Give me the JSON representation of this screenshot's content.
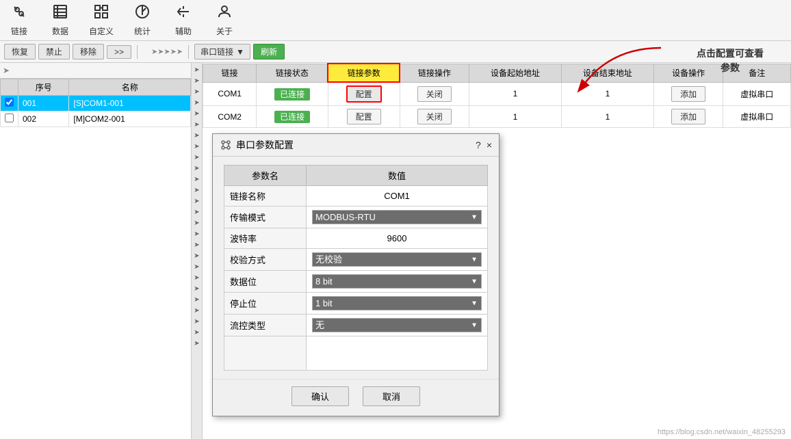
{
  "toolbar": {
    "items": [
      {
        "icon": "🔗",
        "label": "链接"
      },
      {
        "icon": "📄",
        "label": "数据"
      },
      {
        "icon": "📋",
        "label": "自定义"
      },
      {
        "icon": "📊",
        "label": "统计"
      },
      {
        "icon": "📎",
        "label": "辅助"
      },
      {
        "icon": "👤",
        "label": "关于"
      }
    ]
  },
  "second_toolbar": {
    "restore": "恢复",
    "disable": "禁止",
    "remove": "移除",
    "forward": ">>",
    "port_link": "串口链接",
    "refresh": "刷新"
  },
  "left_table": {
    "headers": [
      "序号",
      "名称"
    ],
    "rows": [
      {
        "id": "001",
        "name": "[S]COM1-001",
        "selected": true
      },
      {
        "id": "002",
        "name": "[M]COM2-001",
        "selected": false
      }
    ]
  },
  "right_table": {
    "headers": [
      "链接",
      "链接状态",
      "链接参数",
      "链接操作",
      "设备起始地址",
      "设备结束地址",
      "设备操作",
      "备注"
    ],
    "rows": [
      {
        "link": "COM1",
        "status": "已连接",
        "config_btn": "配置",
        "close_btn": "关闭",
        "start_addr": "1",
        "end_addr": "1",
        "add_btn": "添加",
        "note": "虚拟串口"
      },
      {
        "link": "COM2",
        "status": "已连接",
        "config_btn": "配置",
        "close_btn": "关闭",
        "start_addr": "1",
        "end_addr": "1",
        "add_btn": "添加",
        "note": "虚拟串口"
      }
    ]
  },
  "annotation": {
    "line1": "点击配置可查看",
    "line2": "参数"
  },
  "modal": {
    "title": "串口参数配置",
    "help_btn": "?",
    "close_btn": "×",
    "table": {
      "col1": "参数名",
      "col2": "数值",
      "rows": [
        {
          "param": "链接名称",
          "value": "COM1",
          "type": "text"
        },
        {
          "param": "传输模式",
          "value": "MODBUS-RTU",
          "type": "select"
        },
        {
          "param": "波特率",
          "value": "9600",
          "type": "text"
        },
        {
          "param": "校验方式",
          "value": "无校验",
          "type": "select"
        },
        {
          "param": "数据位",
          "value": "8 bit",
          "type": "select"
        },
        {
          "param": "停止位",
          "value": "1 bit",
          "type": "select"
        },
        {
          "param": "流控类型",
          "value": "无",
          "type": "select"
        }
      ]
    },
    "confirm_btn": "确认",
    "cancel_btn": "取消"
  },
  "watermark": "https://blog.csdn.net/waixin_48255293"
}
